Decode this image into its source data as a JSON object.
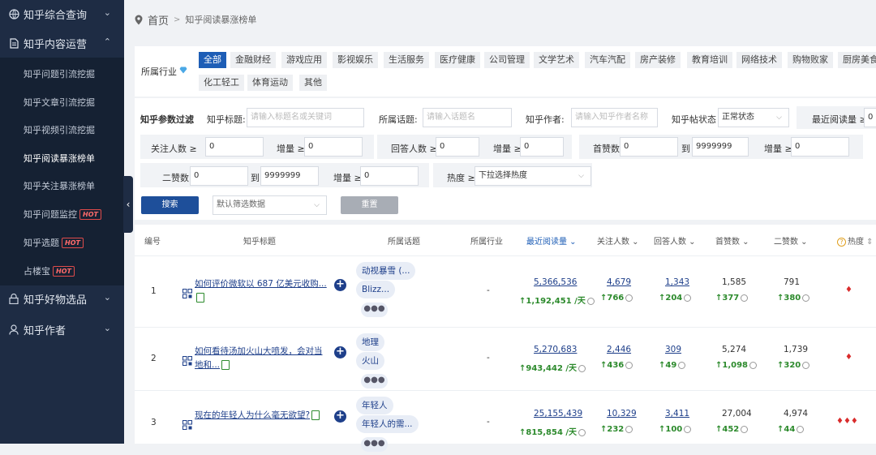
{
  "sidebar": {
    "groups": [
      {
        "label": "知乎综合查询"
      },
      {
        "label": "知乎内容运营"
      },
      {
        "label": "知乎好物选品"
      },
      {
        "label": "知乎作者"
      }
    ],
    "items": [
      {
        "label": "知乎问题引流挖掘"
      },
      {
        "label": "知乎文章引流挖掘"
      },
      {
        "label": "知乎视频引流挖掘"
      },
      {
        "label": "知乎阅读暴涨榜单"
      },
      {
        "label": "知乎关注暴涨榜单"
      },
      {
        "label": "知乎问题监控",
        "badge": "HOT"
      },
      {
        "label": "知乎选题",
        "badge": "HOT"
      },
      {
        "label": "占楼宝",
        "badge": "HOT"
      }
    ]
  },
  "breadcrumb": {
    "home": "首页",
    "sep": ">",
    "current": "知乎阅读暴涨榜单"
  },
  "industry": {
    "label": "所属行业",
    "tags": [
      "全部",
      "金融财经",
      "游戏应用",
      "影视娱乐",
      "生活服务",
      "医疗健康",
      "公司管理",
      "文学艺术",
      "汽车汽配",
      "房产装修",
      "教育培训",
      "网络技术",
      "购物败家",
      "厨房美食",
      "化工轻工",
      "体育运动",
      "其他"
    ]
  },
  "filters": {
    "section_label": "知乎参数过滤",
    "title_label": "知乎标题:",
    "title_placeholder": "请输入标题名或关键词",
    "topic_label": "所属话题:",
    "topic_placeholder": "请输入话题名",
    "author_label": "知乎作者:",
    "author_placeholder": "请输入知乎作者名称",
    "status_label": "知乎帖状态",
    "status_value": "正常状态",
    "recent_read_label": "最近阅读量 ≥",
    "recent_read_value": "0",
    "follow_label": "关注人数 ≥",
    "follow_value": "0",
    "follow_inc_label": "增量 ≥",
    "follow_inc_value": "0",
    "answer_label": "回答人数 ≥",
    "answer_value": "0",
    "answer_inc_label": "增量 ≥",
    "answer_inc_value": "0",
    "first_like_label": "首赞数",
    "first_like_min": "0",
    "to": "到",
    "first_like_max": "9999999",
    "first_like_inc_label": "增量 ≥",
    "first_like_inc_value": "0",
    "second_like_label": "二赞数",
    "second_like_min": "0",
    "second_like_max": "9999999",
    "second_like_inc_label": "增量 ≥",
    "second_like_inc_value": "0",
    "heat_label": "热度 ≥",
    "heat_value": "下拉选择热度",
    "search_btn": "搜索",
    "default_filter": "默认筛选数据",
    "reset_btn": "重置"
  },
  "table": {
    "headers": [
      "编号",
      "知乎标题",
      "所属话题",
      "所属行业",
      "最近阅读量",
      "关注人数",
      "回答人数",
      "首赞数",
      "二赞数",
      "热度"
    ],
    "rows": [
      {
        "no": "1",
        "title": "如何评价微软以 687 亿美元收购...",
        "topics": [
          "动视暴雪 (...",
          "Blizz..."
        ],
        "industry": "-",
        "read": "5,366,536",
        "read_inc": "↑1,192,451 /天",
        "follow": "4,679",
        "follow_inc": "↑766",
        "answer": "1,343",
        "answer_inc": "↑204",
        "like1": "1,585",
        "like1_inc": "↑377",
        "like2": "791",
        "like2_inc": "↑380",
        "heat": 1
      },
      {
        "no": "2",
        "title": "如何看待汤加火山大喷发，会对当地和...",
        "topics": [
          "地理",
          "火山"
        ],
        "industry": "-",
        "read": "5,270,683",
        "read_inc": "↑943,442 /天",
        "follow": "2,446",
        "follow_inc": "↑436",
        "answer": "309",
        "answer_inc": "↑49",
        "like1": "5,274",
        "like1_inc": "↑1,098",
        "like2": "1,739",
        "like2_inc": "↑320",
        "heat": 1
      },
      {
        "no": "3",
        "title": "现在的年轻人为什么毫无欲望?",
        "topics": [
          "年轻人",
          "年轻人的需..."
        ],
        "industry": "-",
        "read": "25,155,439",
        "read_inc": "↑815,854 /天",
        "follow": "10,329",
        "follow_inc": "↑232",
        "answer": "3,411",
        "answer_inc": "↑100",
        "like1": "27,004",
        "like1_inc": "↑452",
        "like2": "4,974",
        "like2_inc": "↑44",
        "heat": 3
      }
    ]
  },
  "colors": {
    "sidebar": "#1e2c44",
    "accent": "#1e5eb6",
    "increase": "#2c8a2c",
    "hot": "#d92c2c"
  }
}
